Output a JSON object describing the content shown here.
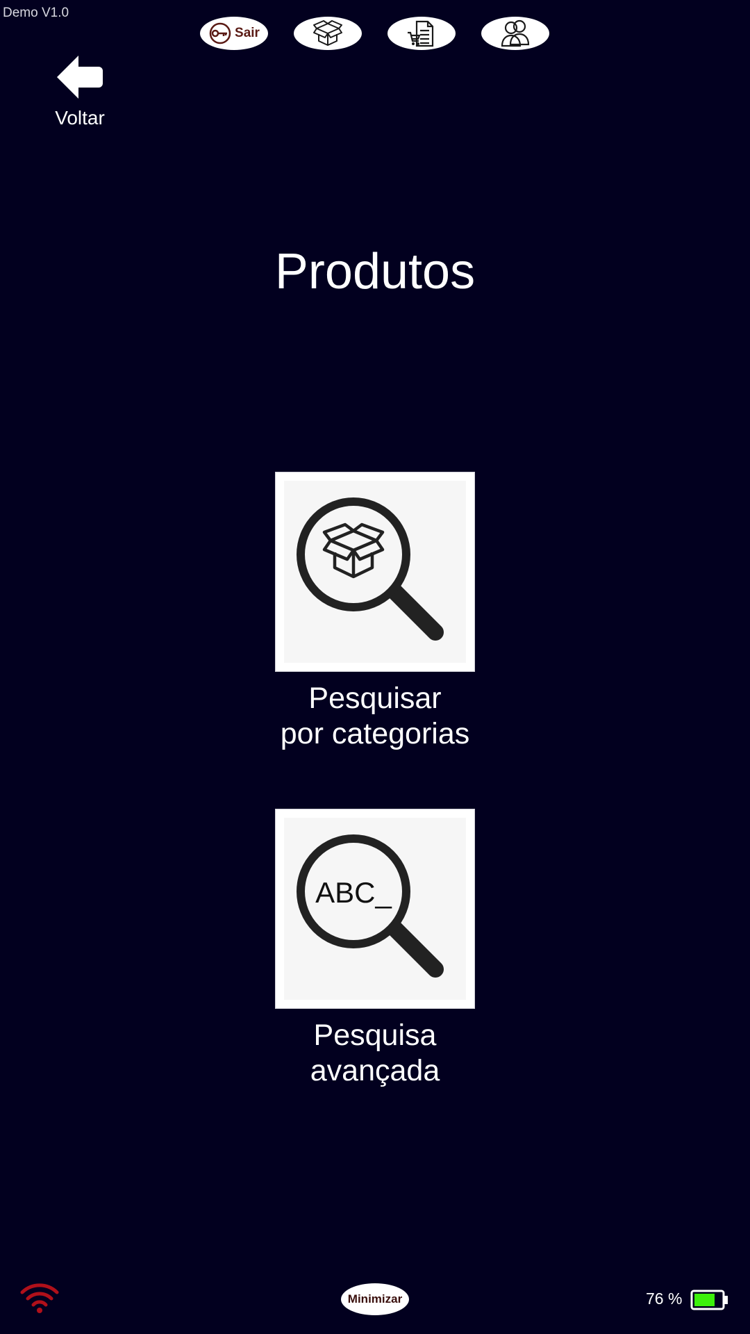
{
  "app": {
    "version": "Demo V1.0"
  },
  "topbar": {
    "logout_label": "Sair",
    "buttons": [
      {
        "id": "logout",
        "icon": "key-icon"
      },
      {
        "id": "products",
        "icon": "box-icon"
      },
      {
        "id": "orders",
        "icon": "cart-document-icon"
      },
      {
        "id": "users",
        "icon": "users-icon"
      }
    ],
    "logout_text_color": "#5a1a14"
  },
  "back": {
    "label": "Voltar",
    "icon": "arrow-left-icon"
  },
  "page": {
    "title": "Produtos"
  },
  "tiles": [
    {
      "line1": "Pesquisar",
      "line2": "por categorias",
      "icon": "magnifier-box-icon"
    },
    {
      "line1": "Pesquisa",
      "line2": "avançada",
      "icon": "magnifier-abc-icon",
      "glyph_text": "ABC_"
    }
  ],
  "footer": {
    "minimize_label": "Minimizar",
    "battery_text": "76 %",
    "battery_level": 0.76,
    "wifi_icon": "wifi-icon",
    "wifi_color": "#b0101a",
    "battery_fill_color": "#3cf00c"
  },
  "colors": {
    "background": "#02001f",
    "text": "#ffffff"
  }
}
